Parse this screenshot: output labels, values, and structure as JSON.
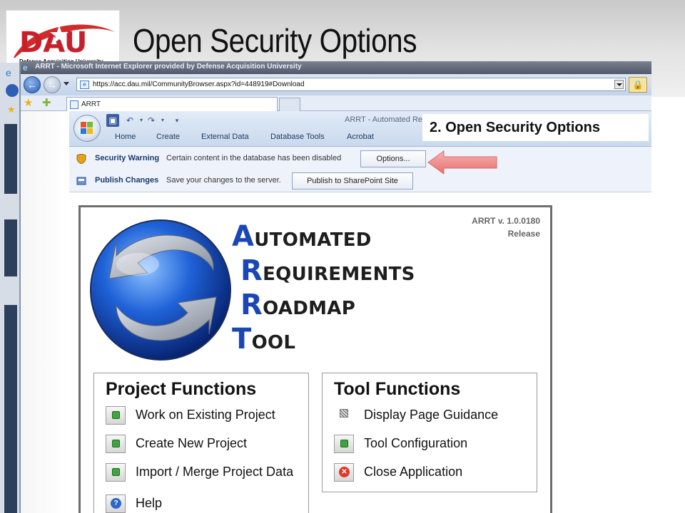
{
  "slide": {
    "title": "Open Security Options",
    "logo_text": "DAU",
    "logo_subtext": "Defense Acquisition University"
  },
  "browser": {
    "window_title": "ARRT - Microsoft Internet Explorer provided by Defense Acquisition University",
    "url": "https://acc.dau.mil/CommunityBrowser.aspx?id=448919#Download",
    "tab_label": "ARRT"
  },
  "access": {
    "app_title": "ARRT - Automated Re",
    "ribbon_tabs": [
      "Home",
      "Create",
      "External Data",
      "Database Tools",
      "Acrobat"
    ],
    "security_warning": {
      "label": "Security Warning",
      "text": "Certain content in the database has been disabled",
      "button": "Options..."
    },
    "publish": {
      "label": "Publish Changes",
      "text": "Save your changes to the server.",
      "button": "Publish to SharePoint Site"
    }
  },
  "callout": {
    "text": "2.  Open Security Options",
    "accent_color": "#f08a8a"
  },
  "form": {
    "version_line1": "ARRT v. 1.0.0180",
    "version_line2": "Release",
    "wordmark": [
      {
        "cap": "A",
        "rest": "UTOMATED"
      },
      {
        "cap": "R",
        "rest": "EQUIREMENTS"
      },
      {
        "cap": "R",
        "rest": "OADMAP"
      },
      {
        "cap": "T",
        "rest": "OOL"
      }
    ],
    "project_functions": {
      "title": "Project Functions",
      "items": [
        "Work on Existing Project",
        "Create New Project",
        "Import / Merge Project Data",
        "Help"
      ]
    },
    "tool_functions": {
      "title": "Tool Functions",
      "items": [
        "Display Page Guidance",
        "Tool Configuration",
        "Close Application"
      ]
    }
  }
}
